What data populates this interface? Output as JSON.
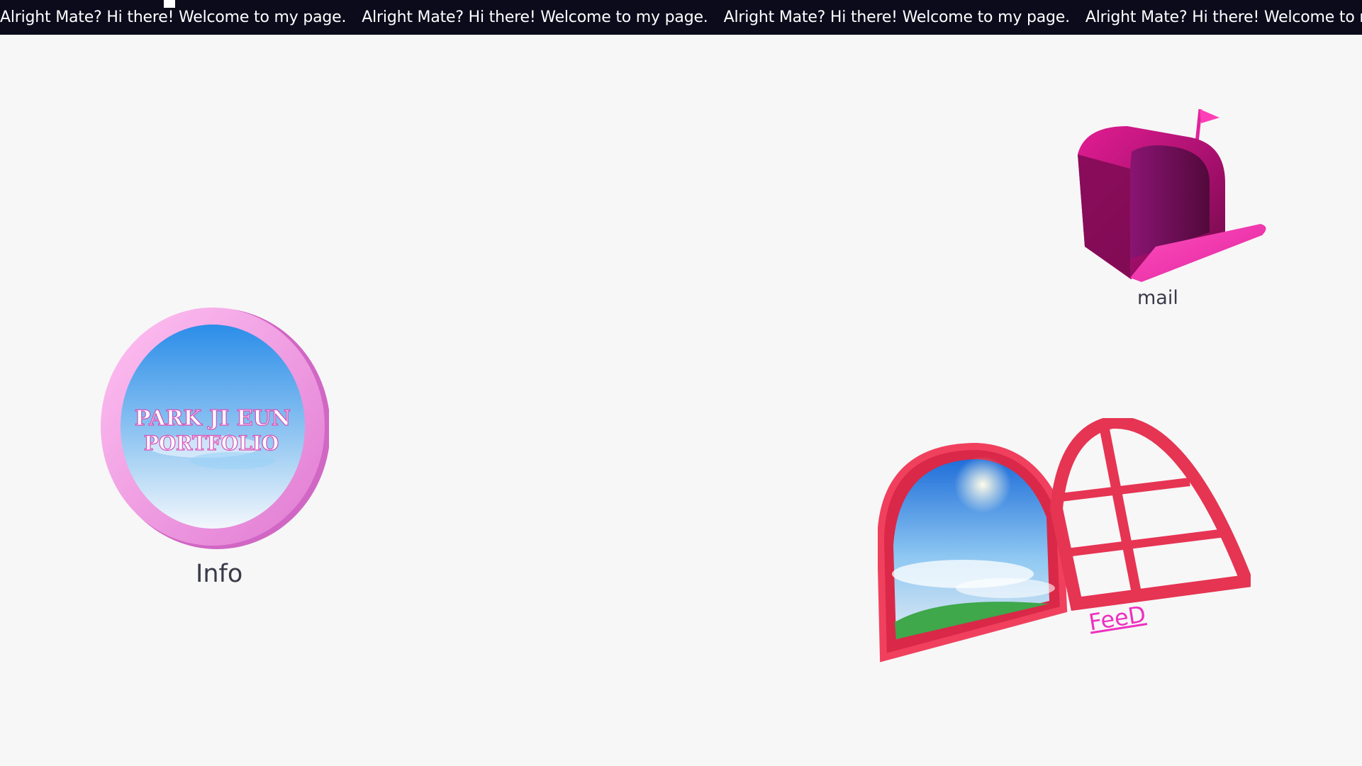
{
  "marquee": {
    "items": [
      "Alright Mate? Hi there! Welcome to my page.",
      "Alright Mate? Hi there! Welcome to my page.",
      "Alright Mate? Hi there! Welcome to my page.",
      "Alright Mate? Hi there! Welcome to my page."
    ]
  },
  "desktop": {
    "mail": {
      "label": "mail",
      "icon": "mailbox-icon"
    },
    "info": {
      "label": "Info",
      "icon": "portfolio-mirror-icon",
      "logo_text": [
        "PARK JI EUN",
        "PORTFOLIO"
      ]
    },
    "feed": {
      "label": "FeeD",
      "icon": "window-icon"
    }
  },
  "colors": {
    "background": "#f7f7f7",
    "marquee_bg": "#0b0b1c",
    "marquee_text": "#ffffff",
    "mailbox": "#c0157e",
    "mirror_frame": "#f7a6e8",
    "window_frame": "#f0405e",
    "feed_link": "#ee2fc0"
  }
}
